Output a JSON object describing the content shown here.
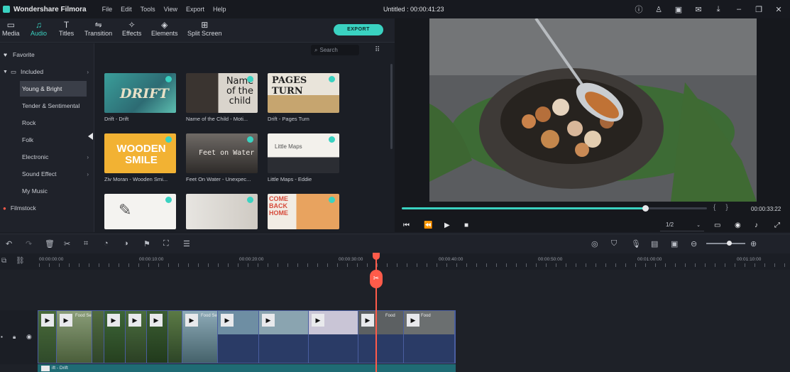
{
  "titlebar": {
    "app_name": "Wondershare Filmora",
    "menus": [
      "File",
      "Edit",
      "Tools",
      "View",
      "Export",
      "Help"
    ],
    "project_title": "Untitled : 00:00:41:23"
  },
  "toolbar": {
    "tabs": [
      {
        "label": "Media",
        "icon": "folder-icon"
      },
      {
        "label": "Audio",
        "icon": "music-note-icon",
        "active": true
      },
      {
        "label": "Titles",
        "icon": "text-icon"
      },
      {
        "label": "Transition",
        "icon": "transition-icon"
      },
      {
        "label": "Effects",
        "icon": "effects-icon"
      },
      {
        "label": "Elements",
        "icon": "elements-icon"
      },
      {
        "label": "Split Screen",
        "icon": "split-screen-icon"
      }
    ],
    "export_label": "EXPORT"
  },
  "sidebar": {
    "favorite": "Favorite",
    "included": "Included",
    "items": [
      "Young & Bright",
      "Tender & Sentimental",
      "Rock",
      "Folk",
      "Electronic",
      "Sound Effect",
      "My Music"
    ],
    "filmstock": "Filmstock"
  },
  "media": {
    "search_placeholder": "Search",
    "thumbnails": [
      {
        "label": "Drift - Drift",
        "art": "DRIFT"
      },
      {
        "label": "Name of the Child - Moti...",
        "art": "Name of the child"
      },
      {
        "label": "Drift - Pages Turn",
        "art": "PAGES TURN"
      },
      {
        "label": "Ziv Moran - Wooden Smi...",
        "art": "WOODEN SMILE"
      },
      {
        "label": "Feet On Water - Unexpec...",
        "art": "Feet on Water"
      },
      {
        "label": "Little Maps - Eddie",
        "art": "Little Maps"
      },
      {
        "label": "",
        "art": ""
      },
      {
        "label": "",
        "art": ""
      },
      {
        "label": "",
        "art": "COME BACK HOME"
      }
    ]
  },
  "preview": {
    "progress": 0.8,
    "timecode": "00:00:33:22",
    "ratio": "1/2"
  },
  "ruler": {
    "ticks": [
      "00:00:00:00",
      "00:00:10:00",
      "00:00:20:00",
      "00:00:30:00",
      "00:00:40:00",
      "00:00:50:00",
      "00:01:00:00",
      "00:01:10:00"
    ]
  },
  "timeline": {
    "clip_labels": [
      "",
      "Food Se",
      "",
      "",
      "",
      "",
      "Food Se",
      "",
      "",
      "",
      "Food",
      "Food"
    ],
    "audio_label": "ift - Drift"
  },
  "colors": {
    "accent": "#3ad2c1",
    "playhead": "#ff5b4a",
    "video_track": "#2a3b66",
    "audio_track": "#1f6b74"
  }
}
